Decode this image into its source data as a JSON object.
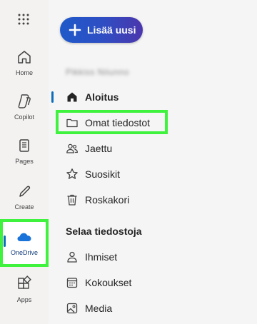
{
  "rail": {
    "items": [
      {
        "label": "Home",
        "icon": "home-icon"
      },
      {
        "label": "Copilot",
        "icon": "copilot-icon"
      },
      {
        "label": "Pages",
        "icon": "pages-icon"
      },
      {
        "label": "Create",
        "icon": "create-icon"
      },
      {
        "label": "OneDrive",
        "icon": "onedrive-icon"
      },
      {
        "label": "Apps",
        "icon": "apps-icon"
      }
    ]
  },
  "new_button": {
    "label": "Lisää uusi",
    "icon": "plus-icon"
  },
  "user": {
    "name": "Pikkiss Niiunno"
  },
  "nav": {
    "items": [
      {
        "label": "Aloitus",
        "icon": "home-icon"
      },
      {
        "label": "Omat tiedostot",
        "icon": "folder-icon"
      },
      {
        "label": "Jaettu",
        "icon": "people-icon"
      },
      {
        "label": "Suosikit",
        "icon": "star-icon"
      },
      {
        "label": "Roskakori",
        "icon": "trash-icon"
      }
    ],
    "section_title": "Selaa tiedostoja",
    "browse_items": [
      {
        "label": "Ihmiset",
        "icon": "person-icon"
      },
      {
        "label": "Kokoukset",
        "icon": "calendar-icon"
      },
      {
        "label": "Media",
        "icon": "image-icon"
      }
    ]
  },
  "colors": {
    "accent": "#0f6cbd",
    "highlight": "#3ef23e",
    "button_gradient_start": "#1f59c9",
    "button_gradient_end": "#4b36ad"
  }
}
